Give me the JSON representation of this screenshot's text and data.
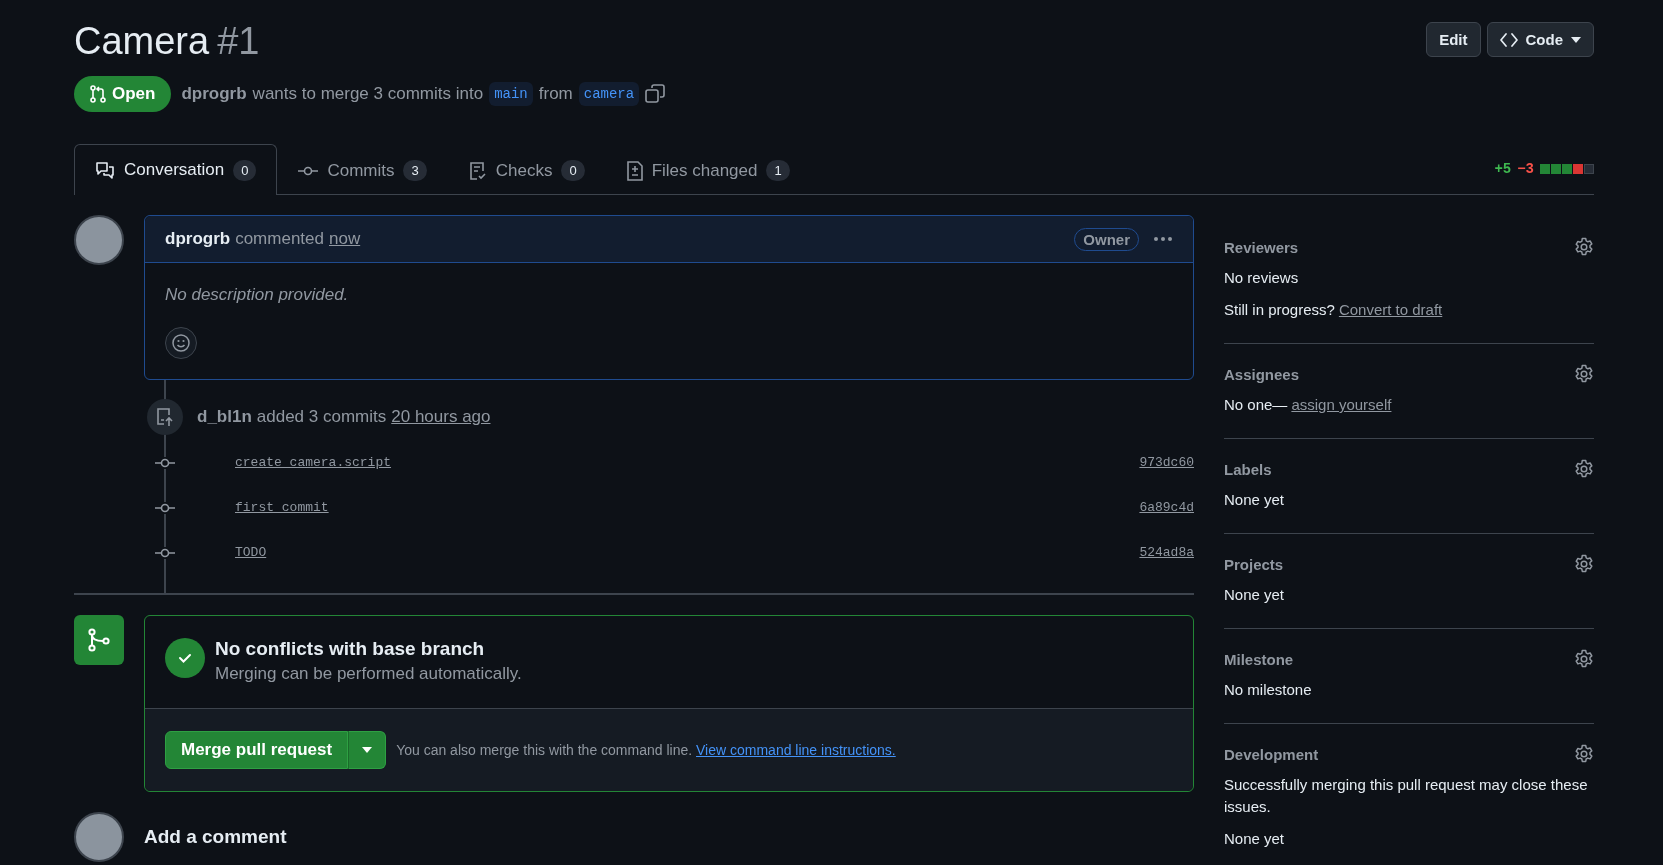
{
  "header": {
    "title": "Camera",
    "number": "#1",
    "buttons": [
      {
        "label": "Edit",
        "kind": "plain"
      },
      {
        "label": "Code",
        "kind": "code"
      }
    ]
  },
  "status": {
    "state": "Open",
    "author": "dprogrb",
    "text": "wants to merge 3 commits into",
    "base": "main",
    "from": "from",
    "head": "camera"
  },
  "tabs": [
    {
      "label": "Conversation",
      "count": "0",
      "selected": true
    },
    {
      "label": "Commits",
      "count": "3",
      "selected": false
    },
    {
      "label": "Checks",
      "count": "0",
      "selected": false
    },
    {
      "label": "Files changed",
      "count": "1",
      "selected": false
    }
  ],
  "diffstat": {
    "additions": "+5",
    "deletions": "−3",
    "blocks": [
      {
        "kind": "added"
      },
      {
        "kind": "added"
      },
      {
        "kind": "added"
      },
      {
        "kind": "removed"
      },
      {
        "kind": "neutral"
      }
    ]
  },
  "comment": {
    "author": "dprogrb",
    "action": "commented",
    "time": "now",
    "badge": "Owner",
    "body": "No description provided."
  },
  "commit_event": {
    "author": "d_bl1n",
    "text": "added 3 commits",
    "time": "20 hours ago",
    "commits": [
      {
        "message": "create camera.script",
        "sha": "973dc60"
      },
      {
        "message": "first commit",
        "sha": "6a89c4d"
      },
      {
        "message": "TODO",
        "sha": "524ad8a"
      }
    ]
  },
  "merge": {
    "title": "No conflicts with base branch",
    "subtitle": "Merging can be performed automatically.",
    "button": "Merge pull request",
    "hint": "You can also merge this with the command line.",
    "link": "View command line instructions."
  },
  "add_comment": {
    "title": "Add a comment"
  },
  "sidebar": [
    {
      "title": "Reviewers",
      "lines": [
        {
          "text": "No reviews"
        },
        {
          "text": "Still in progress?",
          "link": "Convert to draft"
        }
      ]
    },
    {
      "title": "Assignees",
      "lines": [
        {
          "text": "No one—",
          "link": "assign yourself"
        }
      ]
    },
    {
      "title": "Labels",
      "lines": [
        {
          "text": "None yet"
        }
      ]
    },
    {
      "title": "Projects",
      "lines": [
        {
          "text": "None yet"
        }
      ]
    },
    {
      "title": "Milestone",
      "lines": [
        {
          "text": "No milestone"
        }
      ]
    },
    {
      "title": "Development",
      "lines": [
        {
          "text": "Successfully merging this pull request may close these issues."
        },
        {
          "text": "None yet"
        }
      ]
    }
  ]
}
